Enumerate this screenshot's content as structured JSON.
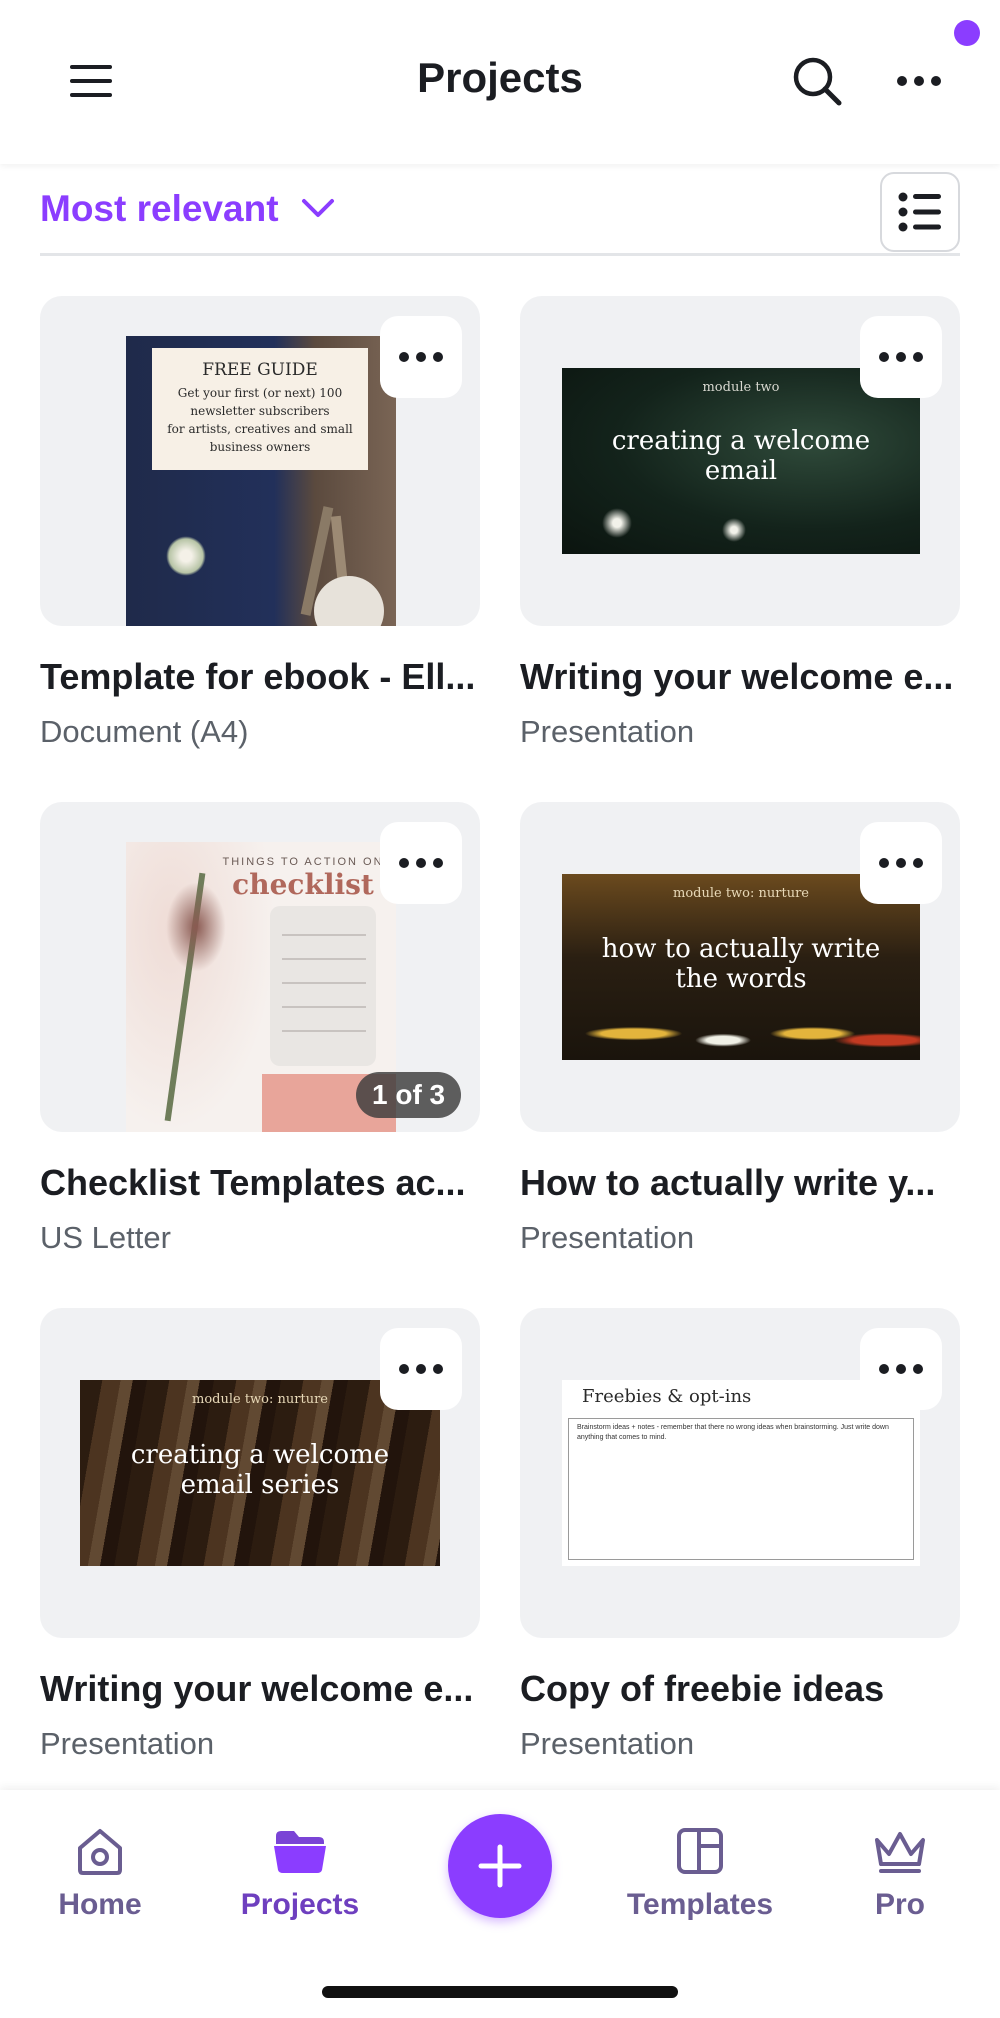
{
  "header": {
    "title": "Projects",
    "menu_icon": "hamburger-menu-icon",
    "search_icon": "search-icon",
    "more_icon": "more-horizontal-icon"
  },
  "sort": {
    "label": "Most relevant",
    "view_toggle_icon": "list-view-icon"
  },
  "projects": [
    {
      "title": "Template for ebook - Ell...",
      "type": "Document (A4)",
      "thumb_lines": [
        "FREE GUIDE",
        "Get your first (or next) 100",
        "newsletter subscribers",
        "for artists, creatives and small",
        "business owners"
      ]
    },
    {
      "title": "Writing your welcome e...",
      "type": "Presentation",
      "thumb_kicker": "module two",
      "thumb_lines": [
        "creating a welcome",
        "email"
      ]
    },
    {
      "title": " Checklist Templates ac...",
      "type": "US Letter",
      "thumb_kicker": "THINGS TO ACTION ON",
      "thumb_heading": "checklist",
      "badge": "1 of 3"
    },
    {
      "title": "How to actually write y...",
      "type": "Presentation",
      "thumb_kicker": "module two: nurture",
      "thumb_lines": [
        "how to actually write",
        "the words"
      ]
    },
    {
      "title": "Writing your welcome e...",
      "type": "Presentation",
      "thumb_kicker": "module two: nurture",
      "thumb_lines": [
        "creating a welcome",
        "email series"
      ]
    },
    {
      "title": "Copy of freebie ideas",
      "type": "Presentation",
      "thumb_heading": "Freebies & opt-ins",
      "thumb_note": "Brainstorm ideas + notes - remember that there no wrong ideas when brainstorming. Just write down anything that comes to mind."
    }
  ],
  "bottom_nav": {
    "home": "Home",
    "projects": "Projects",
    "templates": "Templates",
    "pro": "Pro",
    "create_icon": "plus-icon"
  },
  "colors": {
    "accent": "#8b3dff",
    "text": "#1b1d22",
    "subtext": "#5b6169",
    "card_bg": "#f0f1f3"
  }
}
